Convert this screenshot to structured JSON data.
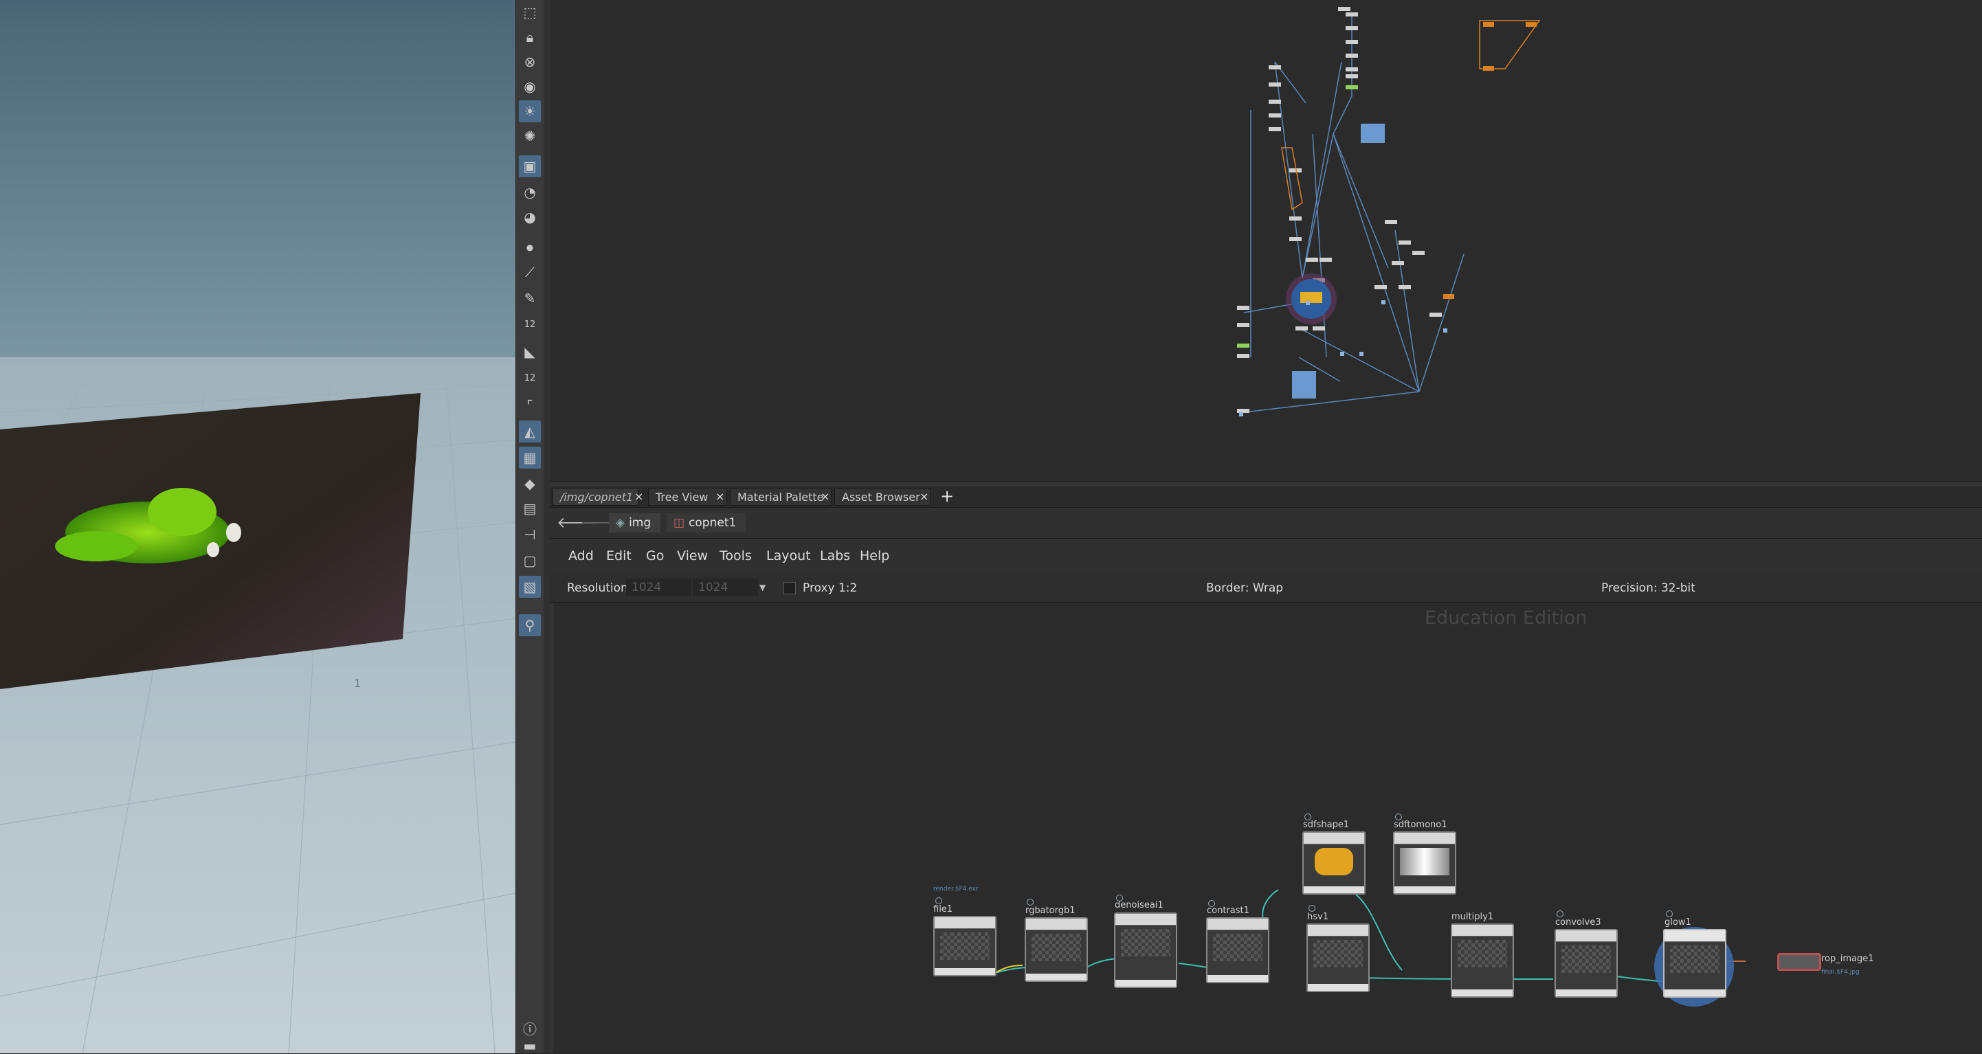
{
  "tabs": [
    {
      "label": "/img/copnet1"
    },
    {
      "label": "Tree View"
    },
    {
      "label": "Material Palette"
    },
    {
      "label": "Asset Browser"
    }
  ],
  "tab_close": "×",
  "tab_add": "+",
  "path": {
    "root": "img",
    "child": "copnet1"
  },
  "menu": [
    "Add",
    "Edit",
    "Go",
    "View",
    "Tools",
    "Layout",
    "Labs",
    "Help"
  ],
  "options": {
    "resolution_label": "Resolution",
    "res_x": "1024",
    "res_y": "1024",
    "proxy": "Proxy 1:2",
    "border": "Border: Wrap",
    "precision": "Precision: 32-bit"
  },
  "watermark": "Education Edition",
  "nodes": {
    "file1": {
      "name": "file1",
      "caption": "render.$F4.exr"
    },
    "rgbatorgb1": {
      "name": "rgbatorgb1"
    },
    "denoiseai1": {
      "name": "denoiseai1"
    },
    "contrast1": {
      "name": "contrast1"
    },
    "sdfshape1": {
      "name": "sdfshape1"
    },
    "sdftomono1": {
      "name": "sdftomono1"
    },
    "hsv1": {
      "name": "hsv1"
    },
    "multiply1": {
      "name": "multiply1"
    },
    "convolve3": {
      "name": "convolve3"
    },
    "glow1": {
      "name": "glow1"
    },
    "rop_image1": {
      "name": "rop_image1",
      "caption": "final.$F4.jpg"
    }
  },
  "viewport_marker": "1",
  "toolbar_numbers": [
    "12",
    "12"
  ],
  "colors": {
    "accent": "#4b6a8a",
    "wire_cop": "#3fbfae",
    "wire_top": "#5a86b8",
    "selection": "#3d6aa8",
    "node_orange": "#d9811f"
  }
}
